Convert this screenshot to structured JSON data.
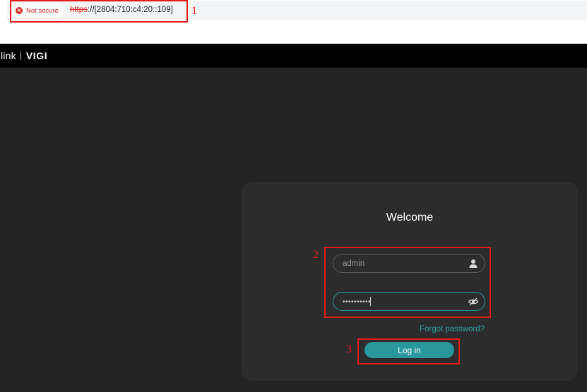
{
  "browser": {
    "security_label": "Not secure",
    "url_scheme": "https",
    "url_rest": "://[2804:710:c4:20::109]"
  },
  "annotations": [
    "1",
    "2",
    "3"
  ],
  "header": {
    "brand_left": "link",
    "brand_right": "VIGI"
  },
  "login": {
    "title": "Welcome",
    "username_value": "admin",
    "password_value": "••••••••••",
    "forgot_label": "Forgot password?",
    "login_label": "Log in"
  },
  "colors": {
    "accent": "#2a979d",
    "annotation": "#e21b1b",
    "background": "#232323",
    "card": "#2c2c2c"
  }
}
